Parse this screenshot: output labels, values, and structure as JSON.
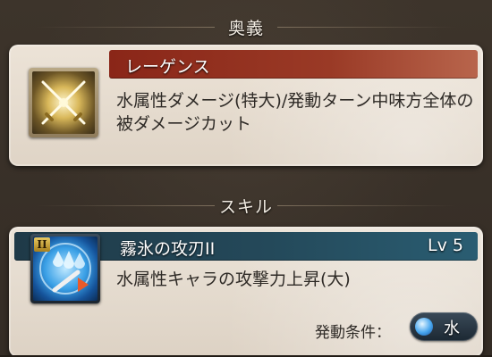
{
  "sections": {
    "ougi_header": "奥義",
    "skill_header": "スキル"
  },
  "ougi": {
    "name": "レーゲンス",
    "description": "水属性ダメージ(特大)/発動ターン中味方全体の被ダメージカット",
    "icon": "crossed-swords-icon"
  },
  "skill": {
    "name": "霧氷の攻刃II",
    "level": "Lv 5",
    "rank_badge": "II",
    "description": "水属性キャラの攻撃力上昇(大)",
    "condition_label": "発動条件：",
    "element": "水",
    "icon": "water-blade-icon"
  },
  "colors": {
    "ougi_titlebar": "#8a2618",
    "skill_titlebar": "#1f3a48",
    "panel_bg": "#ece3d7",
    "water": "#3aa0e6"
  }
}
